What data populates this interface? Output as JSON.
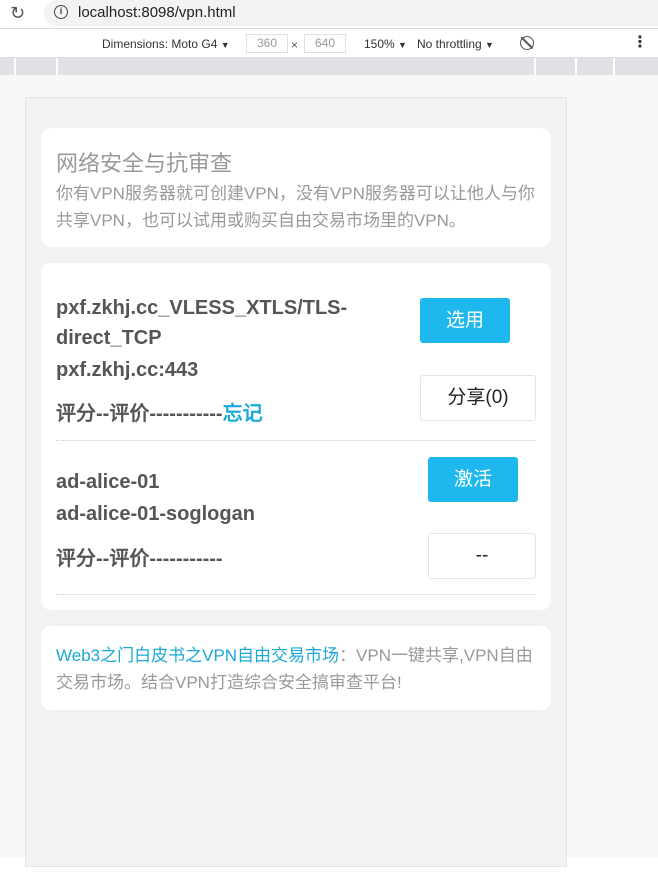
{
  "browser": {
    "url": "localhost:8098/vpn.html"
  },
  "devtools": {
    "dimensions_label": "Dimensions: Moto G4",
    "width": "360",
    "times": "×",
    "height": "640",
    "zoom": "150%",
    "throttling": "No throttling",
    "dropdown_glyph": "▼",
    "menu_glyph": "⋮"
  },
  "intro": {
    "title": "网络安全与抗审查",
    "description": "你有VPN服务器就可创建VPN，没有VPN服务器可以让他人与你共享VPN，也可以试用或购买自由交易市场里的VPN。"
  },
  "vpn_list": [
    {
      "name": "pxf.zkhj.cc_VLESS_XTLS/TLS-direct_TCP",
      "address": "pxf.zkhj.cc:443",
      "rating_label": "评分--评价-----------",
      "rating_link": "忘记",
      "primary_action": "选用",
      "secondary_action": "分享(0)"
    },
    {
      "name": "ad-alice-01",
      "address": "ad-alice-01-soglogan",
      "rating_label": "评分--评价-----------",
      "primary_action": "激活",
      "secondary_action": "--"
    }
  ],
  "footer": {
    "link_text": "Web3之门白皮书之VPN自由交易市场",
    "text": "：VPN一键共享,VPN自由交易市场。结合VPN打造综合安全搞审查平台!"
  },
  "colors": {
    "accent": "#1fb8ee",
    "link": "#1ba8d8",
    "muted_text": "#999999",
    "body_text": "#555555"
  }
}
